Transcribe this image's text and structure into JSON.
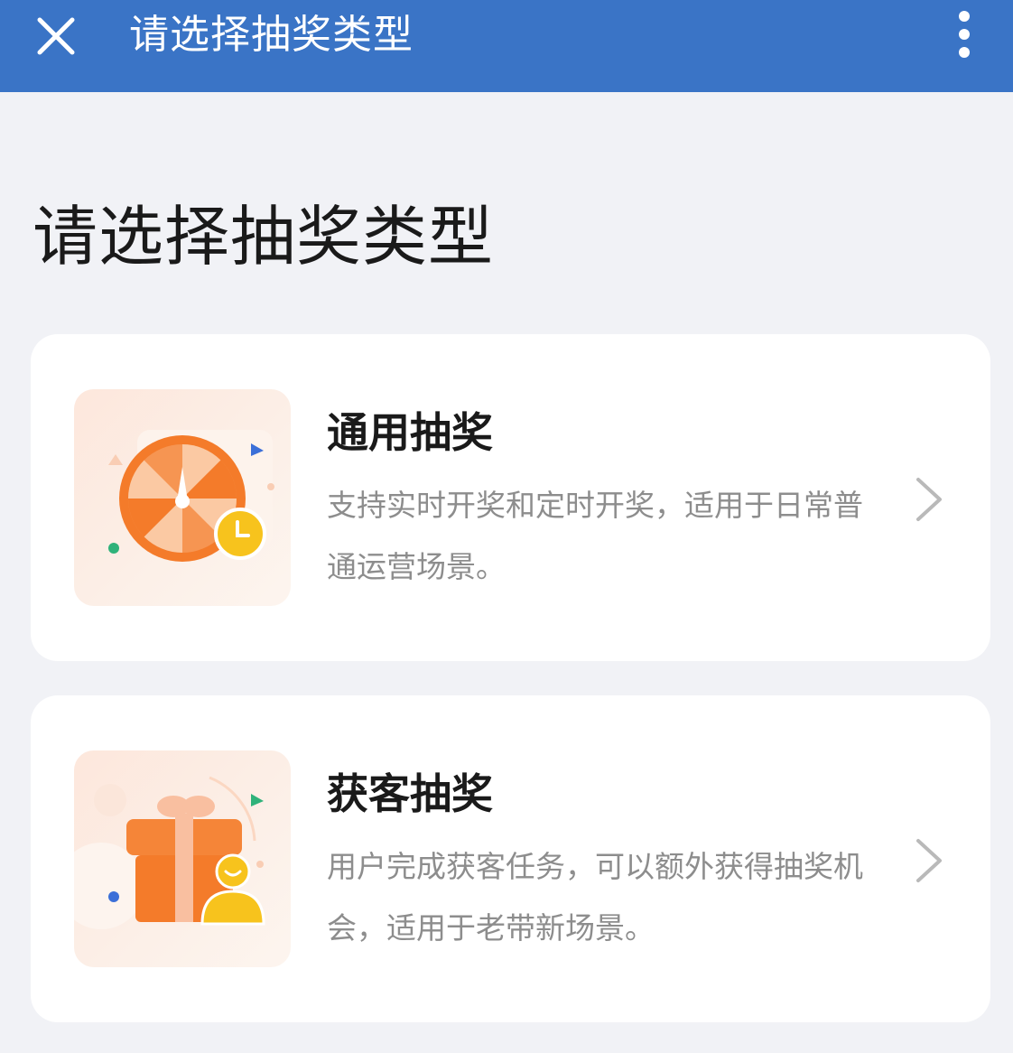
{
  "header": {
    "title": "请选择抽奖类型",
    "close_icon": "close-icon",
    "more_icon": "more-vertical-icon",
    "background_color": "#3a74c6"
  },
  "page": {
    "title": "请选择抽奖类型"
  },
  "lottery_types": [
    {
      "name": "通用抽奖",
      "description": "支持实时开奖和定时开奖，适用于日常普通运营场景。",
      "icon": "prize-wheel-clock-icon"
    },
    {
      "name": "获客抽奖",
      "description": "用户完成获客任务，可以额外获得抽奖机会，适用于老带新场景。",
      "icon": "gift-box-user-icon"
    }
  ],
  "colors": {
    "accent_orange": "#f47b2a",
    "accent_yellow": "#f7c31d",
    "description_gray": "#8d8d8d"
  }
}
